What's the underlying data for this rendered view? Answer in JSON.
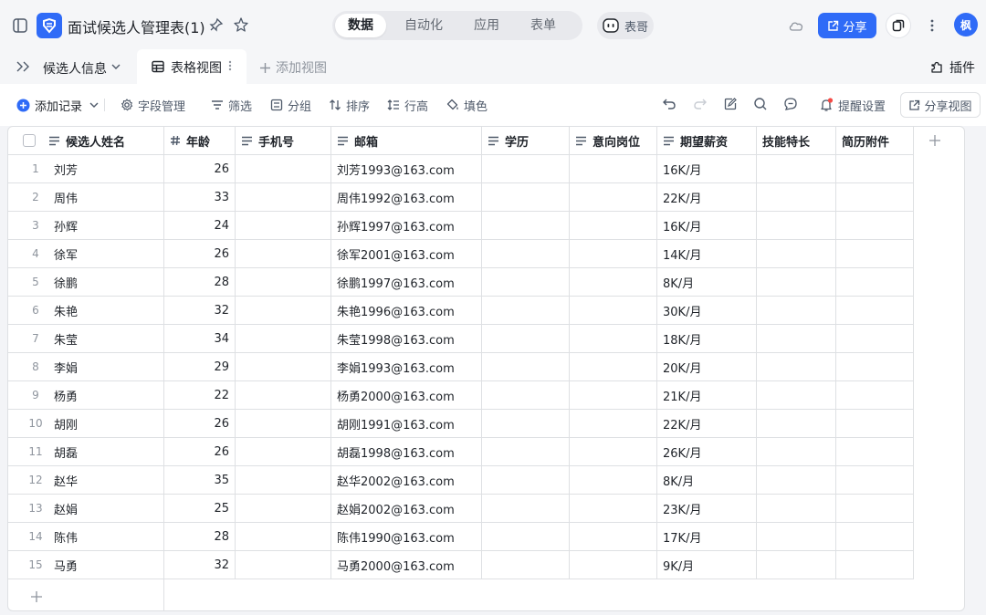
{
  "header": {
    "title": "面试候选人管理表(1)",
    "modes": [
      "数据",
      "自动化",
      "应用",
      "表单"
    ],
    "active_mode": "数据",
    "ai_label": "表哥",
    "share_label": "分享",
    "avatar_text": "枫",
    "accent_color": "#2f6bf7"
  },
  "viewbar": {
    "table_name": "候选人信息",
    "view_name": "表格视图",
    "add_view_label": "添加视图",
    "plugins_label": "插件"
  },
  "toolbar": {
    "add_record": "添加记录",
    "fields": "字段管理",
    "filter": "筛选",
    "group": "分组",
    "sort": "排序",
    "row_height": "行高",
    "fill_color": "填色",
    "reminder": "提醒设置",
    "share_view": "分享视图"
  },
  "table": {
    "columns": [
      "候选人姓名",
      "年龄",
      "手机号",
      "邮箱",
      "学历",
      "意向岗位",
      "期望薪资",
      "技能特长",
      "简历附件"
    ],
    "rows": [
      {
        "n": "1",
        "name": "刘芳",
        "age": "26",
        "phone": "",
        "email": "刘芳1993@163.com",
        "edu": "",
        "pos": "",
        "salary": "16K/月",
        "skill": "",
        "resume": ""
      },
      {
        "n": "2",
        "name": "周伟",
        "age": "33",
        "phone": "",
        "email": "周伟1992@163.com",
        "edu": "",
        "pos": "",
        "salary": "22K/月",
        "skill": "",
        "resume": ""
      },
      {
        "n": "3",
        "name": "孙辉",
        "age": "24",
        "phone": "",
        "email": "孙辉1997@163.com",
        "edu": "",
        "pos": "",
        "salary": "16K/月",
        "skill": "",
        "resume": ""
      },
      {
        "n": "4",
        "name": "徐军",
        "age": "26",
        "phone": "",
        "email": "徐军2001@163.com",
        "edu": "",
        "pos": "",
        "salary": "14K/月",
        "skill": "",
        "resume": ""
      },
      {
        "n": "5",
        "name": "徐鹏",
        "age": "28",
        "phone": "",
        "email": "徐鹏1997@163.com",
        "edu": "",
        "pos": "",
        "salary": "8K/月",
        "skill": "",
        "resume": ""
      },
      {
        "n": "6",
        "name": "朱艳",
        "age": "32",
        "phone": "",
        "email": "朱艳1996@163.com",
        "edu": "",
        "pos": "",
        "salary": "30K/月",
        "skill": "",
        "resume": ""
      },
      {
        "n": "7",
        "name": "朱莹",
        "age": "34",
        "phone": "",
        "email": "朱莹1998@163.com",
        "edu": "",
        "pos": "",
        "salary": "18K/月",
        "skill": "",
        "resume": ""
      },
      {
        "n": "8",
        "name": "李娟",
        "age": "29",
        "phone": "",
        "email": "李娟1993@163.com",
        "edu": "",
        "pos": "",
        "salary": "20K/月",
        "skill": "",
        "resume": ""
      },
      {
        "n": "9",
        "name": "杨勇",
        "age": "22",
        "phone": "",
        "email": "杨勇2000@163.com",
        "edu": "",
        "pos": "",
        "salary": "21K/月",
        "skill": "",
        "resume": ""
      },
      {
        "n": "10",
        "name": "胡刚",
        "age": "26",
        "phone": "",
        "email": "胡刚1991@163.com",
        "edu": "",
        "pos": "",
        "salary": "22K/月",
        "skill": "",
        "resume": ""
      },
      {
        "n": "11",
        "name": "胡磊",
        "age": "26",
        "phone": "",
        "email": "胡磊1998@163.com",
        "edu": "",
        "pos": "",
        "salary": "26K/月",
        "skill": "",
        "resume": ""
      },
      {
        "n": "12",
        "name": "赵华",
        "age": "35",
        "phone": "",
        "email": "赵华2002@163.com",
        "edu": "",
        "pos": "",
        "salary": "8K/月",
        "skill": "",
        "resume": ""
      },
      {
        "n": "13",
        "name": "赵娟",
        "age": "25",
        "phone": "",
        "email": "赵娟2002@163.com",
        "edu": "",
        "pos": "",
        "salary": "23K/月",
        "skill": "",
        "resume": ""
      },
      {
        "n": "14",
        "name": "陈伟",
        "age": "28",
        "phone": "",
        "email": "陈伟1990@163.com",
        "edu": "",
        "pos": "",
        "salary": "17K/月",
        "skill": "",
        "resume": ""
      },
      {
        "n": "15",
        "name": "马勇",
        "age": "32",
        "phone": "",
        "email": "马勇2000@163.com",
        "edu": "",
        "pos": "",
        "salary": "9K/月",
        "skill": "",
        "resume": ""
      }
    ]
  }
}
